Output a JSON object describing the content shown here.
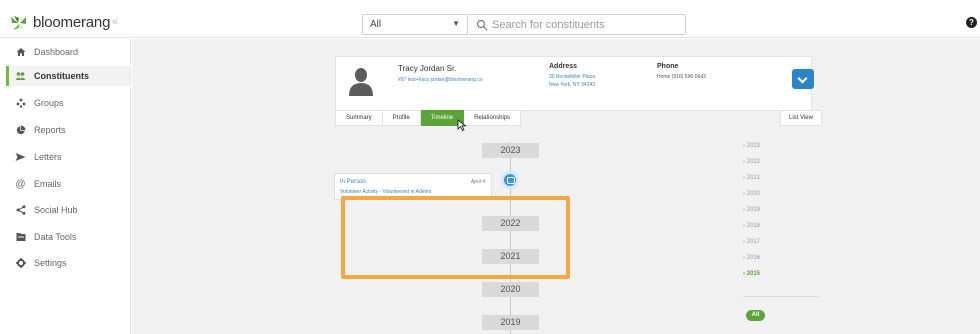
{
  "app": {
    "name": "bloomerang",
    "collapse_glyph": "«",
    "brand_color": "#5aa43b",
    "accent_color": "#3a95d5"
  },
  "search": {
    "filter_value": "All",
    "placeholder": "Search for constituents"
  },
  "sidebar": {
    "items": [
      {
        "label": "Dashboard",
        "icon": "home-icon",
        "active": false
      },
      {
        "label": "Constituents",
        "icon": "people-icon",
        "active": true
      },
      {
        "label": "Groups",
        "icon": "groups-icon",
        "active": false
      },
      {
        "label": "Reports",
        "icon": "reports-icon",
        "active": false
      },
      {
        "label": "Letters",
        "icon": "send-icon",
        "active": false
      },
      {
        "label": "Emails",
        "icon": "at-icon",
        "active": false
      },
      {
        "label": "Social Hub",
        "icon": "share-icon",
        "active": false
      },
      {
        "label": "Data Tools",
        "icon": "data-tools-icon",
        "active": false
      },
      {
        "label": "Settings",
        "icon": "gear-icon",
        "active": false
      }
    ]
  },
  "profile": {
    "name": "Tracy Jordan Sr.",
    "email": "#97 test+tracy.jordan@bloomerang.co",
    "address_label": "Address",
    "address_line1": "30 Rockefeller Plaza",
    "address_line2": "New York, NY 34243",
    "phone_label": "Phone",
    "phone": "Home (916) 596-0643"
  },
  "tabs": [
    "Summary",
    "Profile",
    "Timeline",
    "Relationships"
  ],
  "active_tab": "Timeline",
  "list_view_label": "List View",
  "timeline": {
    "years": [
      "2023",
      "2022",
      "2021",
      "2020",
      "2019"
    ],
    "event": {
      "title": "In Person",
      "date": "April 4",
      "description": "Volunteer Activity - Volunteered in Admini"
    }
  },
  "year_list": {
    "items": [
      "2023",
      "2022",
      "2021",
      "2020",
      "2019",
      "2018",
      "2017",
      "2016",
      "2015"
    ],
    "current": "2015",
    "all_label": "All"
  }
}
